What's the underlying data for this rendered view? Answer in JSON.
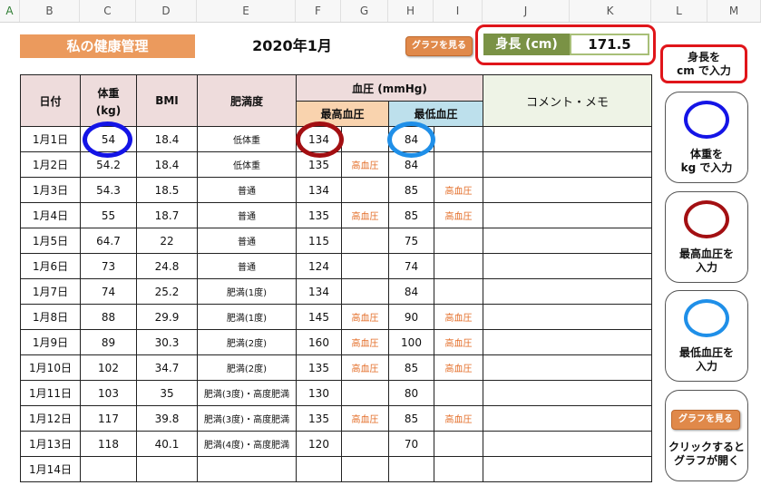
{
  "column_headers": [
    "A",
    "B",
    "C",
    "D",
    "E",
    "F",
    "G",
    "H",
    "I",
    "J",
    "K",
    "L",
    "M"
  ],
  "title": "私の健康管理",
  "month": "2020年1月",
  "graph_button": "グラフを見る",
  "height": {
    "label": "身長 (cm)",
    "value": "171.5"
  },
  "table": {
    "h_date": "日付",
    "h_weight": "体重",
    "h_weight_unit": "(kg)",
    "h_bmi": "BMI",
    "h_obesity": "肥満度",
    "h_bp": "血圧 (mmHg)",
    "h_bp_high": "最高血圧",
    "h_bp_low": "最低血圧",
    "h_comment": "コメント・メモ",
    "rows": [
      {
        "date": "1月1日",
        "weight": "54",
        "bmi": "18.4",
        "obesity": "低体重",
        "high": "134",
        "high_flag": "",
        "low": "84",
        "low_flag": ""
      },
      {
        "date": "1月2日",
        "weight": "54.2",
        "bmi": "18.4",
        "obesity": "低体重",
        "high": "135",
        "high_flag": "高血圧",
        "low": "84",
        "low_flag": ""
      },
      {
        "date": "1月3日",
        "weight": "54.3",
        "bmi": "18.5",
        "obesity": "普通",
        "high": "134",
        "high_flag": "",
        "low": "85",
        "low_flag": "高血圧"
      },
      {
        "date": "1月4日",
        "weight": "55",
        "bmi": "18.7",
        "obesity": "普通",
        "high": "135",
        "high_flag": "高血圧",
        "low": "85",
        "low_flag": "高血圧"
      },
      {
        "date": "1月5日",
        "weight": "64.7",
        "bmi": "22",
        "obesity": "普通",
        "high": "115",
        "high_flag": "",
        "low": "75",
        "low_flag": ""
      },
      {
        "date": "1月6日",
        "weight": "73",
        "bmi": "24.8",
        "obesity": "普通",
        "high": "124",
        "high_flag": "",
        "low": "74",
        "low_flag": ""
      },
      {
        "date": "1月7日",
        "weight": "74",
        "bmi": "25.2",
        "obesity": "肥満(1度)",
        "high": "134",
        "high_flag": "",
        "low": "84",
        "low_flag": ""
      },
      {
        "date": "1月8日",
        "weight": "88",
        "bmi": "29.9",
        "obesity": "肥満(1度)",
        "high": "145",
        "high_flag": "高血圧",
        "low": "90",
        "low_flag": "高血圧"
      },
      {
        "date": "1月9日",
        "weight": "89",
        "bmi": "30.3",
        "obesity": "肥満(2度)",
        "high": "160",
        "high_flag": "高血圧",
        "low": "100",
        "low_flag": "高血圧"
      },
      {
        "date": "1月10日",
        "weight": "102",
        "bmi": "34.7",
        "obesity": "肥満(2度)",
        "high": "135",
        "high_flag": "高血圧",
        "low": "85",
        "low_flag": "高血圧"
      },
      {
        "date": "1月11日",
        "weight": "103",
        "bmi": "35",
        "obesity": "肥満(3度)・高度肥満",
        "high": "130",
        "high_flag": "",
        "low": "80",
        "low_flag": ""
      },
      {
        "date": "1月12日",
        "weight": "117",
        "bmi": "39.8",
        "obesity": "肥満(3度)・高度肥満",
        "high": "135",
        "high_flag": "高血圧",
        "low": "85",
        "low_flag": "高血圧"
      },
      {
        "date": "1月13日",
        "weight": "118",
        "bmi": "40.1",
        "obesity": "肥満(4度)・高度肥満",
        "high": "120",
        "high_flag": "",
        "low": "70",
        "low_flag": ""
      },
      {
        "date": "1月14日",
        "weight": "",
        "bmi": "",
        "obesity": "",
        "high": "",
        "high_flag": "",
        "low": "",
        "low_flag": ""
      }
    ]
  },
  "sidebar": {
    "height_note": "身長を\ncm で入力",
    "weight_note": "体重を\nkg で入力",
    "high_note": "最高血圧を\n入力",
    "low_note": "最低血圧を\n入力",
    "graph_note": "クリックすると\nグラフが開く"
  },
  "colors": {
    "title_bg": "#eb9a5d",
    "height_label_bg": "#7a9245",
    "highlight_red": "#e0151a",
    "circle_weight": "#1414e6",
    "circle_high": "#a30f12",
    "circle_low": "#1f8fe8",
    "warn_text": "#e36c26"
  }
}
